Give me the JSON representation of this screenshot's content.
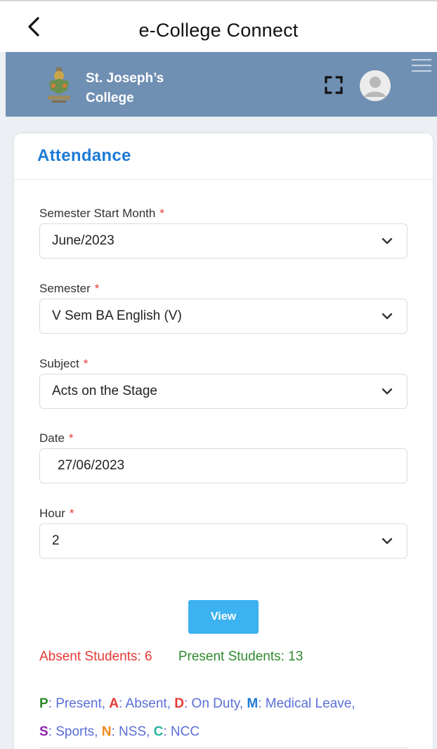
{
  "app": {
    "title": "e-College Connect"
  },
  "header": {
    "college_name_line1": "St. Joseph’s",
    "college_name_line2": "College"
  },
  "card": {
    "title": "Attendance"
  },
  "form": {
    "semester_start_month": {
      "label": "Semester Start Month",
      "required": "*",
      "value": "June/2023"
    },
    "semester": {
      "label": "Semester",
      "required": "*",
      "value": "V Sem BA English (V)"
    },
    "subject": {
      "label": "Subject",
      "required": "*",
      "value": "Acts on the Stage"
    },
    "date": {
      "label": "Date",
      "required": "*",
      "value": "27/06/2023"
    },
    "hour": {
      "label": "Hour",
      "required": "*",
      "value": "2"
    }
  },
  "view_button": {
    "label": "View"
  },
  "counts": {
    "absent": "Absent Students: 6",
    "present": "Present Students: 13"
  },
  "legend": {
    "items": [
      {
        "key": "P",
        "text": ": Present,",
        "color": "#2e8b2e"
      },
      {
        "key": "A",
        "text": ": Absent,",
        "color": "#e53935"
      },
      {
        "key": "D",
        "text": ": On Duty,",
        "color": "#e53935"
      },
      {
        "key": "M",
        "text": ": Medical Leave,",
        "color": "#1e7bd6"
      },
      {
        "key": "S",
        "text": ": Sports,",
        "color": "#8e24aa"
      },
      {
        "key": "N",
        "text": ": NSS,",
        "color": "#f08c1e"
      },
      {
        "key": "C",
        "text": ": NCC",
        "color": "#26b5a0"
      }
    ]
  },
  "colors": {
    "header_bg": "#6f8fb3",
    "title_blue": "#1e7bd6",
    "view_button": "#3db2f0",
    "absent_red": "#e53935",
    "present_green": "#2e8b2e"
  },
  "icons": [
    "back-arrow-icon",
    "college-logo",
    "fullscreen-icon",
    "user-avatar-icon",
    "hamburger-menu-icon",
    "chevron-down-icon"
  ]
}
